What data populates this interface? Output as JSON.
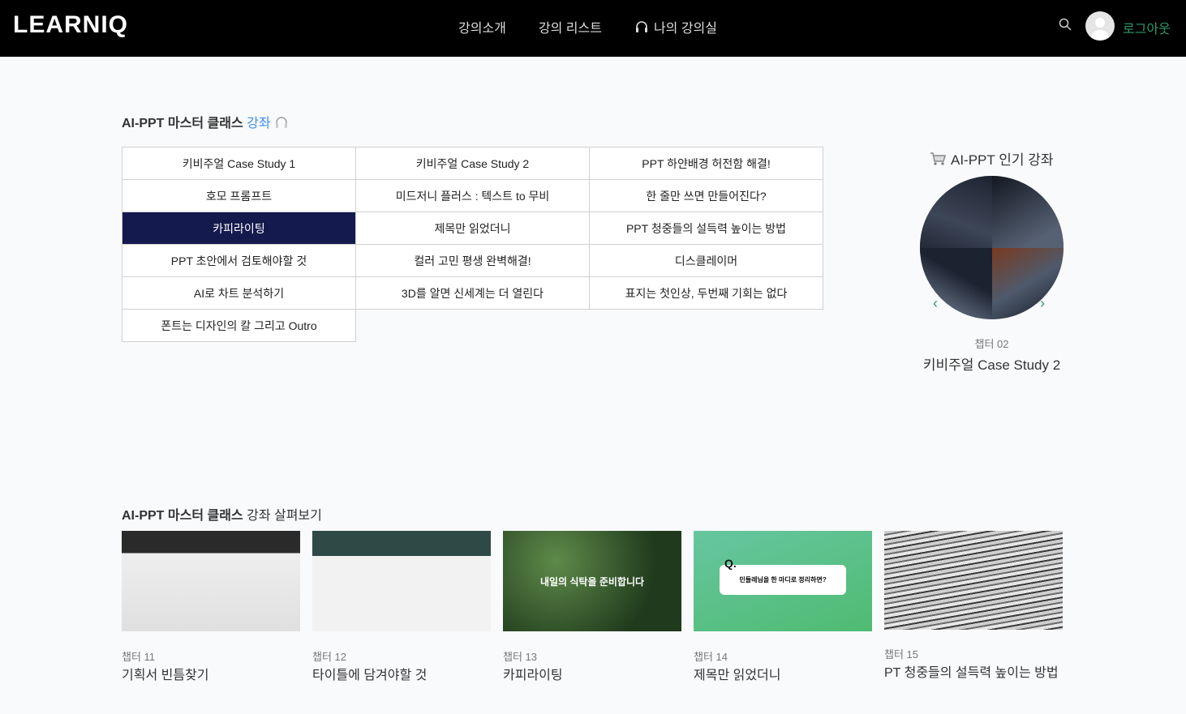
{
  "nav": {
    "logo": "LEARNIQ",
    "menu": [
      "강의소개",
      "강의 리스트",
      "나의 강의실"
    ],
    "logout": "로그아웃"
  },
  "section1": {
    "title_bold": "AI-PPT 마스터 클래스",
    "title_accent": "강좌"
  },
  "lessons": [
    [
      "키비주얼 Case Study 1",
      "키비주얼 Case Study 2",
      "PPT 하얀배경 허전함 해결!"
    ],
    [
      "호모 프롬프트",
      "미드저니 플러스 : 텍스트 to 무비",
      "한 줄만 쓰면 만들어진다?"
    ],
    [
      "카피라이팅",
      "제목만 읽었더니",
      "PPT 청중들의 설득력 높이는 방법"
    ],
    [
      "PPT 초안에서 검토해야할 것",
      "컬러 고민 평생 완벽해결!",
      "디스클레이머"
    ],
    [
      "AI로 차트 분석하기",
      "3D를 알면 신세계는 더 열린다",
      "표지는 첫인상, 두번째 기회는 없다"
    ],
    [
      "폰트는 디자인의 칼 그리고 Outro"
    ]
  ],
  "active_lesson": "카피라이팅",
  "popular": {
    "title": "AI-PPT 인기 강좌",
    "chapter": "챕터 02",
    "name": "키비주얼 Case Study 2"
  },
  "section2": {
    "title_bold": "AI-PPT 마스터 클래스",
    "title_rest": "강좌 살펴보기"
  },
  "cards": [
    {
      "chapter": "챕터 11",
      "name": "기획서 빈틈찾기"
    },
    {
      "chapter": "챕터 12",
      "name": "타이틀에 담겨야할 것"
    },
    {
      "chapter": "챕터 13",
      "name": "카피라이팅",
      "thumb_text": "내일의 식탁을 준비합니다"
    },
    {
      "chapter": "챕터 14",
      "name": "제목만 읽었더니",
      "thumb_q": "Q.",
      "thumb_text": "민들레님을 한 마디로 정리하면?"
    },
    {
      "chapter": "챕터 15",
      "name": "PT 청중들의 설득력 높이는 방법"
    }
  ],
  "colors": {
    "accent": "#3b8ee8",
    "logout": "#2e9a6a",
    "active": "#141a4e"
  }
}
